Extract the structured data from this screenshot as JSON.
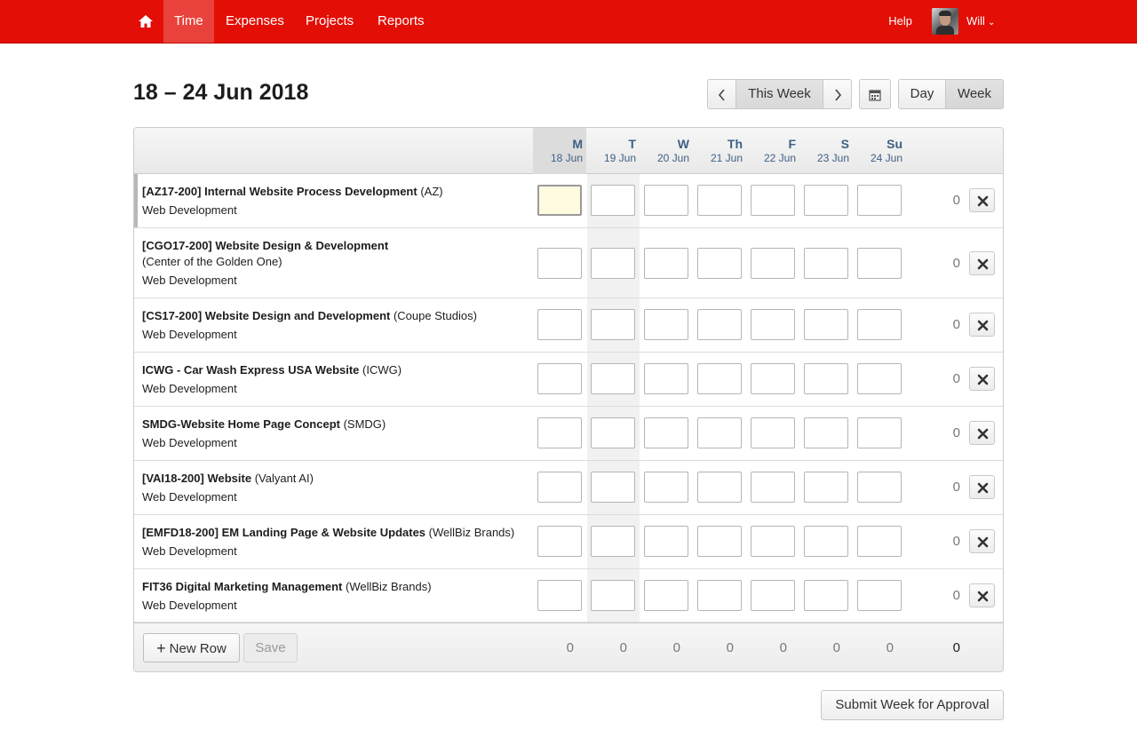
{
  "nav": {
    "items": [
      {
        "label": "Time",
        "active": true
      },
      {
        "label": "Expenses",
        "active": false
      },
      {
        "label": "Projects",
        "active": false
      },
      {
        "label": "Reports",
        "active": false
      }
    ],
    "help_label": "Help",
    "user_name": "Will",
    "brand_color": "#e30e06"
  },
  "header": {
    "title": "18 – 24 Jun 2018",
    "this_week_label": "This Week",
    "day_label": "Day",
    "week_label": "Week"
  },
  "days": [
    {
      "abbr": "M",
      "date": "18 Jun",
      "today": true
    },
    {
      "abbr": "T",
      "date": "19 Jun",
      "today": false
    },
    {
      "abbr": "W",
      "date": "20 Jun",
      "today": false
    },
    {
      "abbr": "Th",
      "date": "21 Jun",
      "today": false
    },
    {
      "abbr": "F",
      "date": "22 Jun",
      "today": false
    },
    {
      "abbr": "S",
      "date": "23 Jun",
      "today": false
    },
    {
      "abbr": "Su",
      "date": "24 Jun",
      "today": false
    }
  ],
  "rows": [
    {
      "project": "[AZ17-200] Internal Website Process Development",
      "client": "(AZ)",
      "task": "Web Development",
      "total": "0"
    },
    {
      "project": "[CGO17-200] Website Design & Development",
      "client": "(Center of the Golden One)",
      "task": "Web Development",
      "total": "0"
    },
    {
      "project": "[CS17-200] Website Design and Development",
      "client": "(Coupe Studios)",
      "task": "Web Development",
      "total": "0"
    },
    {
      "project": "ICWG - Car Wash Express USA Website",
      "client": "(ICWG)",
      "task": "Web Development",
      "total": "0"
    },
    {
      "project": "SMDG-Website Home Page Concept",
      "client": "(SMDG)",
      "task": "Web Development",
      "total": "0"
    },
    {
      "project": "[VAI18-200] Website",
      "client": "(Valyant AI)",
      "task": "Web Development",
      "total": "0"
    },
    {
      "project": "[EMFD18-200] EM Landing Page & Website Updates",
      "client": "(WellBiz Brands)",
      "task": "Web Development",
      "total": "0"
    },
    {
      "project": "FIT36 Digital Marketing Management",
      "client": "(WellBiz Brands)",
      "task": "Web Development",
      "total": "0"
    }
  ],
  "footer": {
    "new_row_label": "New Row",
    "save_label": "Save",
    "day_totals": [
      "0",
      "0",
      "0",
      "0",
      "0",
      "0",
      "0"
    ],
    "grand_total": "0"
  },
  "submit_label": "Submit Week for Approval"
}
